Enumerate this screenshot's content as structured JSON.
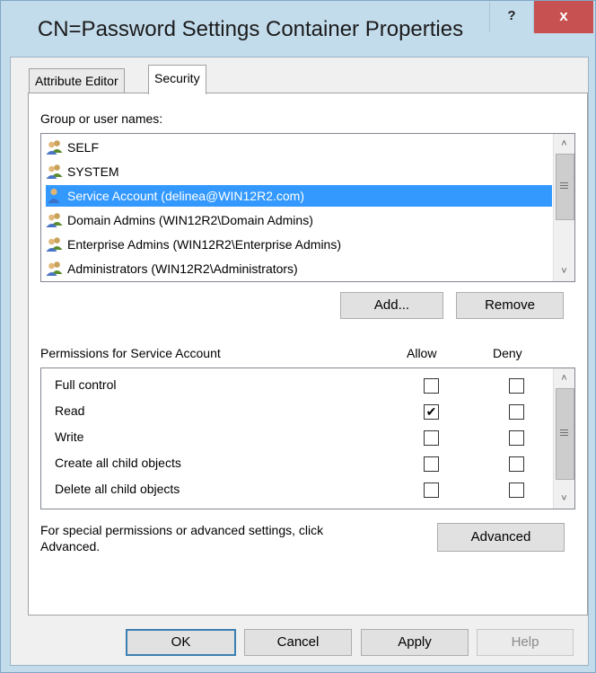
{
  "window": {
    "title": "CN=Password Settings Container Properties",
    "help_label": "?",
    "close_label": "x"
  },
  "tabs": [
    {
      "label": "Attribute Editor",
      "active": false
    },
    {
      "label": "Security",
      "active": true
    }
  ],
  "security": {
    "group_label": "Group or user names:",
    "principals": [
      {
        "name": "SELF",
        "icon": "group-icon",
        "selected": false
      },
      {
        "name": "SYSTEM",
        "icon": "group-icon",
        "selected": false
      },
      {
        "name": "Service Account (delinea@WIN12R2.com)",
        "icon": "user-icon",
        "selected": true
      },
      {
        "name": "Domain Admins (WIN12R2\\Domain Admins)",
        "icon": "group-icon",
        "selected": false
      },
      {
        "name": "Enterprise Admins (WIN12R2\\Enterprise Admins)",
        "icon": "group-icon",
        "selected": false
      },
      {
        "name": "Administrators (WIN12R2\\Administrators)",
        "icon": "group-icon",
        "selected": false
      }
    ],
    "add_label": "Add...",
    "remove_label": "Remove",
    "permissions_label": "Permissions for Service Account",
    "allow_header": "Allow",
    "deny_header": "Deny",
    "permissions": [
      {
        "name": "Full control",
        "allow": false,
        "deny": false
      },
      {
        "name": "Read",
        "allow": true,
        "deny": false
      },
      {
        "name": "Write",
        "allow": false,
        "deny": false
      },
      {
        "name": "Create all child objects",
        "allow": false,
        "deny": false
      },
      {
        "name": "Delete all child objects",
        "allow": false,
        "deny": false
      }
    ],
    "special_line1": "For special permissions or advanced settings, click",
    "special_line2": "Advanced.",
    "advanced_label": "Advanced"
  },
  "footer": {
    "ok_label": "OK",
    "cancel_label": "Cancel",
    "apply_label": "Apply",
    "help_label": "Help"
  },
  "colors": {
    "selection": "#3399ff",
    "titlebar": "#c3dcec",
    "close": "#c75050"
  }
}
